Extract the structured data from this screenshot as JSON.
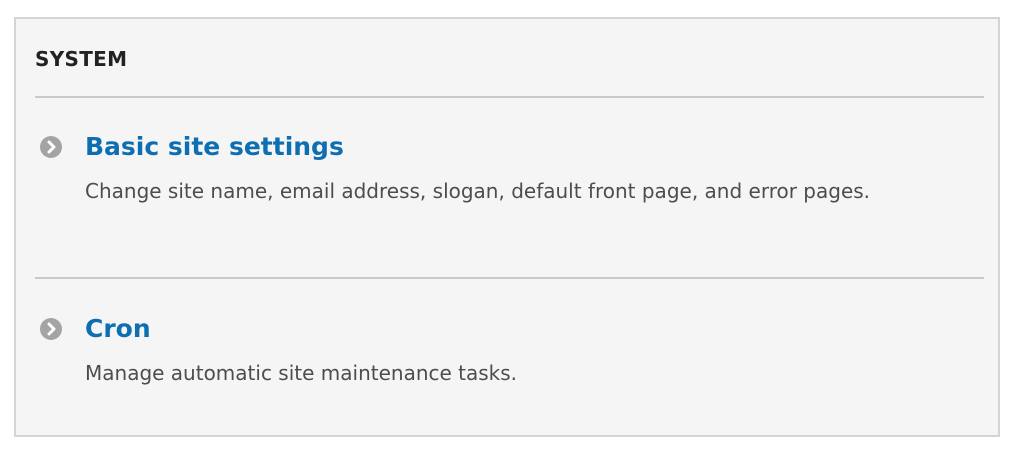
{
  "section": {
    "title": "SYSTEM",
    "items": [
      {
        "icon": "chevron-right-circle-icon",
        "label": "Basic site settings",
        "description": "Change site name, email address, slogan, default front page, and error pages."
      },
      {
        "icon": "chevron-right-circle-icon",
        "label": "Cron",
        "description": "Manage automatic site maintenance tasks."
      }
    ]
  },
  "colors": {
    "link": "#0d6fb2",
    "panel_background": "#f5f5f5",
    "panel_border": "#d4d4d4",
    "icon": "#a4a4a4",
    "description_text": "#4d4d4d"
  }
}
